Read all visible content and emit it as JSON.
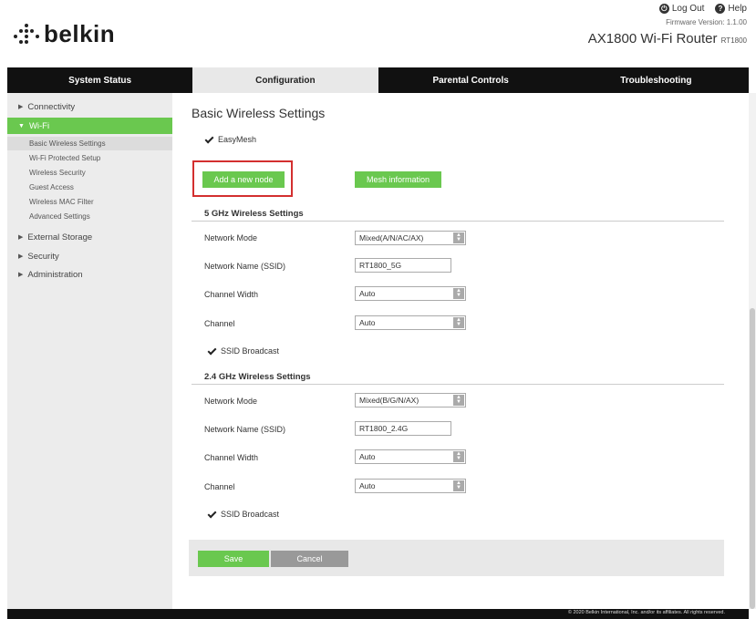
{
  "header": {
    "brand": "belkin",
    "logout_label": "Log Out",
    "help_label": "Help",
    "firmware": "Firmware Version: 1.1.00",
    "router_name": "AX1800 Wi-Fi Router",
    "router_model": "RT1800"
  },
  "nav": {
    "tabs": [
      {
        "label": "System Status"
      },
      {
        "label": "Configuration"
      },
      {
        "label": "Parental Controls"
      },
      {
        "label": "Troubleshooting"
      }
    ],
    "active": "Configuration"
  },
  "sidebar": {
    "items": [
      {
        "label": "Connectivity"
      },
      {
        "label": "Wi-Fi"
      },
      {
        "label": "External Storage"
      },
      {
        "label": "Security"
      },
      {
        "label": "Administration"
      }
    ],
    "wifi_subitems": [
      {
        "label": "Basic Wireless Settings"
      },
      {
        "label": "Wi-Fi Protected Setup"
      },
      {
        "label": "Wireless Security"
      },
      {
        "label": "Guest Access"
      },
      {
        "label": "Wireless MAC Filter"
      },
      {
        "label": "Advanced Settings"
      }
    ]
  },
  "main": {
    "title": "Basic Wireless Settings",
    "easymesh_label": "EasyMesh",
    "add_node_label": "Add a new node",
    "mesh_info_label": "Mesh information",
    "band5": {
      "title": "5 GHz Wireless Settings",
      "network_mode_label": "Network Mode",
      "network_mode_value": "Mixed(A/N/AC/AX)",
      "ssid_label": "Network Name (SSID)",
      "ssid_value": "RT1800_5G",
      "channel_width_label": "Channel Width",
      "channel_width_value": "Auto",
      "channel_label": "Channel",
      "channel_value": "Auto",
      "broadcast_label": "SSID Broadcast"
    },
    "band24": {
      "title": "2.4 GHz Wireless Settings",
      "network_mode_label": "Network Mode",
      "network_mode_value": "Mixed(B/G/N/AX)",
      "ssid_label": "Network Name (SSID)",
      "ssid_value": "RT1800_2.4G",
      "channel_width_label": "Channel Width",
      "channel_width_value": "Auto",
      "channel_label": "Channel",
      "channel_value": "Auto",
      "broadcast_label": "SSID Broadcast"
    },
    "save_label": "Save",
    "cancel_label": "Cancel"
  },
  "footer": {
    "copyright": "© 2020 Belkin International, Inc. and/or its affiliates. All rights reserved."
  },
  "colors": {
    "accent_green": "#6ac84f",
    "nav_black": "#111111",
    "highlight_red": "#d32f2f"
  }
}
